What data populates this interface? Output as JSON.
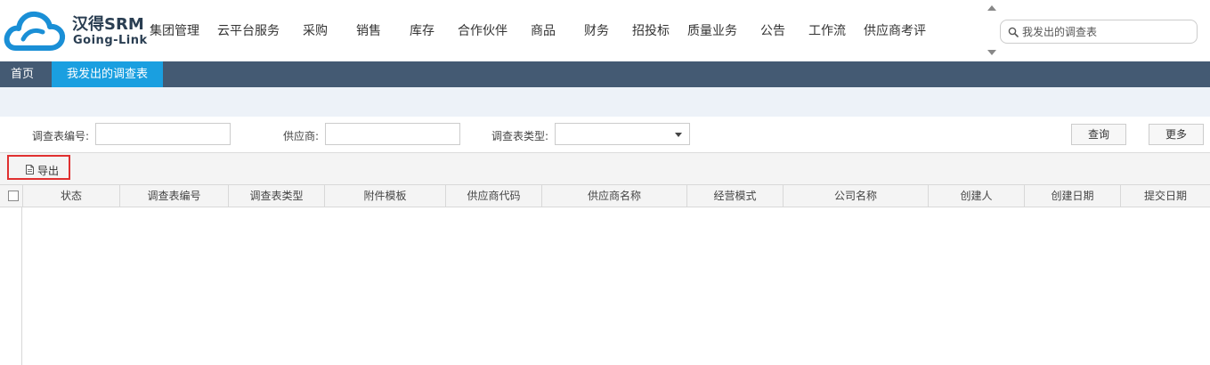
{
  "brand": {
    "name": "汉得SRM",
    "subtitle": "Going-Link",
    "logo_color": "#1a8fd6"
  },
  "nav_items": [
    {
      "label": "集团管理"
    },
    {
      "label": "云平台服务"
    },
    {
      "label": "采购"
    },
    {
      "label": "销售"
    },
    {
      "label": "库存"
    },
    {
      "label": "合作伙伴"
    },
    {
      "label": "商品"
    },
    {
      "label": "财务"
    },
    {
      "label": "招投标"
    },
    {
      "label": "质量业务"
    },
    {
      "label": "公告"
    },
    {
      "label": "工作流"
    },
    {
      "label": "供应商考评"
    }
  ],
  "search": {
    "placeholder": "我发出的调查表",
    "icon": "search-icon"
  },
  "tabs": {
    "home": "首页",
    "active": "我发出的调查表"
  },
  "query_form": {
    "survey_no_label": "调查表编号:",
    "survey_no_value": "",
    "supplier_label": "供应商:",
    "supplier_value": "",
    "survey_type_label": "调查表类型:",
    "survey_type_value": "",
    "query_button": "查询",
    "more_button": "更多"
  },
  "toolbar": {
    "export_label": "导出",
    "export_icon": "document-icon"
  },
  "table": {
    "columns": [
      "状态",
      "调查表编号",
      "调查表类型",
      "附件模板",
      "供应商代码",
      "供应商名称",
      "经营模式",
      "公司名称",
      "创建人",
      "创建日期",
      "提交日期"
    ],
    "rows": []
  },
  "colors": {
    "tabbar_bg": "#445a73",
    "active_tab_bg": "#1a9fe0",
    "highlight_border": "#e03030"
  }
}
